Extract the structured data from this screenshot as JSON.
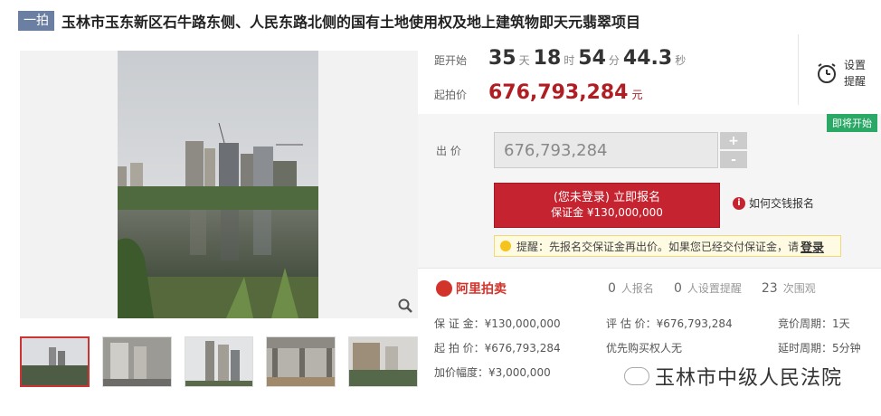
{
  "header": {
    "badge": "一拍",
    "title": "玉林市玉东新区石牛路东侧、人民东路北侧的国有土地使用权及地上建筑物即天元翡翠项目"
  },
  "countdown": {
    "label": "距开始",
    "days": "35",
    "days_unit": "天",
    "hours": "18",
    "hours_unit": "时",
    "minutes": "54",
    "minutes_unit": "分",
    "seconds": "44.3",
    "seconds_unit": "秒"
  },
  "reminder": {
    "line1": "设置",
    "line2": "提醒",
    "icon": "alarm-clock-icon"
  },
  "start_price": {
    "label": "起拍价",
    "value": "676,793,284",
    "unit": "元"
  },
  "bid": {
    "status": "即将开始",
    "label": "出 价",
    "input_value": "676,793,284",
    "plus": "+",
    "minus": "-",
    "signup_line1": "(您未登录) 立即报名",
    "signup_line2": "保证金 ¥130,000,000",
    "howto": "如何交钱报名",
    "tip_text": "提醒：先报名交保证金再出价。如果您已经交付保证金，请",
    "tip_login": "登录"
  },
  "stats": {
    "brand": "阿里拍卖",
    "signups_n": "0",
    "signups_label": "人报名",
    "reminders_n": "0",
    "reminders_label": "人设置提醒",
    "views_n": "23",
    "views_label": "次围观"
  },
  "details": {
    "deposit": "保 证 金：¥130,000,000",
    "appraisal": "评 估 价：¥676,793,284",
    "cycle": "竞价周期：1天",
    "start": "起 拍 价：¥676,793,284",
    "priority": "优先购买权人",
    "priority_value": "无",
    "extension": "延时周期：5分钟",
    "increment": "加价幅度：¥3,000,000"
  },
  "watermark": "玉林市中级人民法院",
  "colors": {
    "accent_red": "#c4232f",
    "status_green": "#2aa865",
    "badge_blue": "#6b7fa3"
  }
}
